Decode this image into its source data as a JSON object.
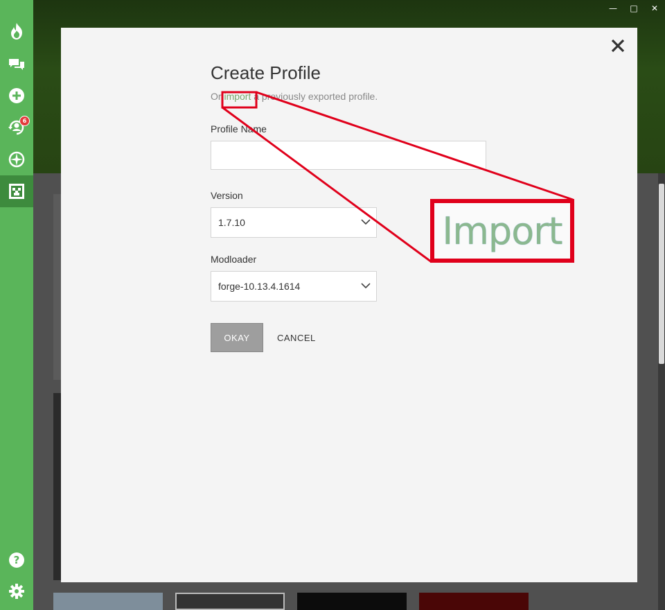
{
  "window": {
    "controls": {
      "minimize": "—",
      "maximize": "□",
      "close": "✕"
    }
  },
  "sidebar": {
    "items": [
      {
        "icon": "flame-icon"
      },
      {
        "icon": "chat-icon"
      },
      {
        "icon": "add-icon"
      },
      {
        "icon": "friends-icon",
        "badge": "6"
      },
      {
        "icon": "compass-icon"
      },
      {
        "icon": "minecraft-icon",
        "active": true
      }
    ],
    "bottom": [
      {
        "icon": "help-icon"
      },
      {
        "icon": "settings-icon"
      }
    ]
  },
  "modal": {
    "title": "Create Profile",
    "subtitle_prefix": "Or",
    "subtitle_link": "import",
    "subtitle_suffix": "a previously exported profile.",
    "profile_name_label": "Profile Name",
    "profile_name_value": "",
    "version_label": "Version",
    "version_value": "1.7.10",
    "modloader_label": "Modloader",
    "modloader_value": "forge-10.13.4.1614",
    "okay_label": "OKAY",
    "cancel_label": "CANCEL"
  },
  "annotation": {
    "zoom_text": "Import",
    "color": "#e0001b"
  }
}
